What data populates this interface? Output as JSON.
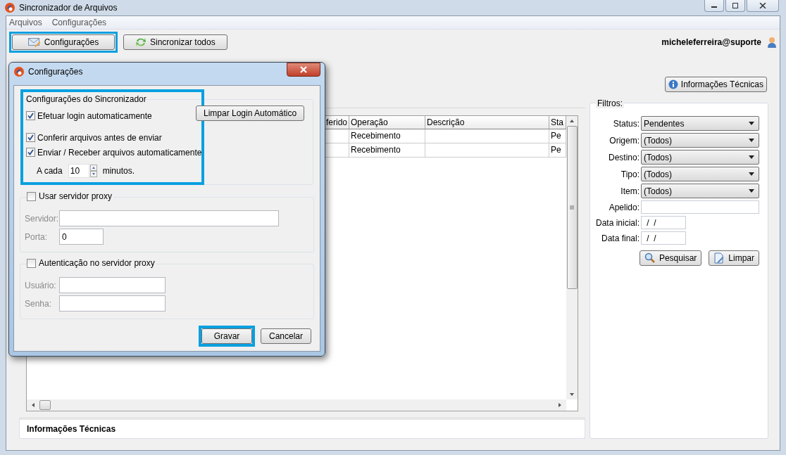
{
  "window": {
    "title": "Sincronizador de Arquivos"
  },
  "menu": [
    "Arquivos",
    "Configurações"
  ],
  "toolbar": [
    {
      "label": "Configurações",
      "highlighted": true
    },
    {
      "label": "Sincronizar todos",
      "highlighted": false
    }
  ],
  "user": "micheleferreira@suporte",
  "info_button": "Informações Técnicas",
  "table": {
    "columns": [
      "ferido",
      "Operação",
      "Descrição",
      "Sta"
    ],
    "rows": [
      [
        "",
        "Recebimento",
        "",
        "Pe"
      ],
      [
        "",
        "Recebimento",
        "",
        "Pe"
      ]
    ]
  },
  "bottom_label": "Informações Técnicas",
  "filters": {
    "title": "Filtros:",
    "fields": [
      {
        "label": "Status:",
        "kind": "select",
        "value": "Pendentes"
      },
      {
        "label": "Origem:",
        "kind": "select",
        "value": "(Todos)"
      },
      {
        "label": "Destino:",
        "kind": "select",
        "value": "(Todos)"
      },
      {
        "label": "Tipo:",
        "kind": "select",
        "value": "(Todos)"
      },
      {
        "label": "Item:",
        "kind": "select",
        "value": "(Todos)"
      },
      {
        "label": "Apelido:",
        "kind": "text"
      },
      {
        "label": "Data inicial:",
        "kind": "date",
        "value": " /  /"
      },
      {
        "label": "Data final:",
        "kind": "date",
        "value": " /  /"
      }
    ],
    "buttons": [
      "Pesquisar",
      "Limpar"
    ]
  },
  "dialog": {
    "title": "Configurações",
    "group": {
      "title": "Configurações do Sincronizador",
      "highlighted": true,
      "options": [
        {
          "label": "Efetuar login automaticamente",
          "checked": true
        },
        {
          "label": "Conferir arquivos antes de enviar",
          "checked": true
        },
        {
          "label": "Enviar / Receber arquivos automaticamente",
          "checked": true
        }
      ],
      "interval_prefix": "A cada",
      "interval": "10",
      "interval_suffix": "minutos.",
      "clear_button": "Limpar Login Automático"
    },
    "proxy": {
      "label": "Usar servidor proxy",
      "checked": false,
      "server_label": "Servidor:",
      "port_label": "Porta:",
      "port": "0"
    },
    "auth": {
      "label": "Autenticação no servidor proxy",
      "checked": false,
      "user_label": "Usuário:",
      "password_label": "Senha:"
    },
    "buttons": [
      {
        "label": "Gravar",
        "highlighted": true
      },
      {
        "label": "Cancelar",
        "highlighted": false
      }
    ]
  }
}
